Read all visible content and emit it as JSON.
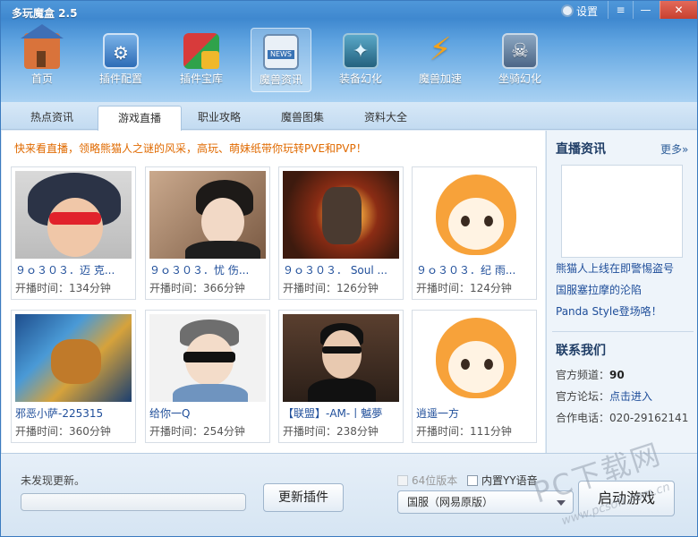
{
  "app": {
    "title": "多玩魔盒 2.5",
    "settings_label": "设置",
    "min_icon": "≡",
    "dash_icon": "—",
    "close_icon": "✕"
  },
  "toolbar": [
    {
      "key": "home",
      "label": "首页",
      "icon": "house-icon"
    },
    {
      "key": "plugin",
      "label": "插件配置",
      "icon": "plugin-config-icon"
    },
    {
      "key": "store",
      "label": "插件宝库",
      "icon": "plugin-store-icon"
    },
    {
      "key": "news",
      "label": "魔兽资讯",
      "icon": "news-icon",
      "active": true
    },
    {
      "key": "equip",
      "label": "装备幻化",
      "icon": "equipment-icon"
    },
    {
      "key": "speed",
      "label": "魔兽加速",
      "icon": "lightning-icon"
    },
    {
      "key": "mount",
      "label": "坐骑幻化",
      "icon": "mount-icon"
    }
  ],
  "subtabs": [
    {
      "label": "热点资讯"
    },
    {
      "label": "游戏直播",
      "active": true
    },
    {
      "label": "职业攻略"
    },
    {
      "label": "魔兽图集"
    },
    {
      "label": "资料大全"
    }
  ],
  "promo_text": "快来看直播，领略熊猫人之谜的风采，高玩、萌妹纸带你玩转PVE和PVP！",
  "streams": [
    {
      "title": "９ｏ３０３．迈 克...",
      "time_label": "开播时间：",
      "time": "134分钟"
    },
    {
      "title": "９ｏ３０３．忧 伤...",
      "time_label": "开播时间：",
      "time": "366分钟"
    },
    {
      "title": "９ｏ３０３．  Soul ...",
      "time_label": "开播时间：",
      "time": "126分钟"
    },
    {
      "title": "９ｏ３０３．纪 雨...",
      "time_label": "开播时间：",
      "time": "124分钟"
    },
    {
      "title": "邪恶小萨-225315",
      "time_label": "开播时间：",
      "time": "360分钟"
    },
    {
      "title": "给你一Q",
      "time_label": "开播时间：",
      "time": "254分钟"
    },
    {
      "title": "【联盟】-AM-丨魆夢",
      "time_label": "开播时间：",
      "time": "238分钟"
    },
    {
      "title": "逍遥一方",
      "time_label": "开播时间：",
      "time": "111分钟"
    }
  ],
  "side": {
    "title": "直播资讯",
    "more": "更多»",
    "links": [
      "熊猫人上线在即警惕盗号",
      "国服塞拉摩的沦陷",
      "Panda Style登场咯！"
    ],
    "contact_title": "联系我们",
    "channel_label": "官方频道：",
    "channel_value": "90",
    "forum_label": "官方论坛：",
    "forum_link": "点击进入",
    "phone_label": "合作电话：",
    "phone_value": "020-29162141"
  },
  "bottom": {
    "update_text": "未发现更新。",
    "progress": 0,
    "update_button": "更新插件",
    "checkbox_64": "64位版本",
    "checkbox_yy": "内置YY语音",
    "server": "国服（网易原版）",
    "start_button": "启动游戏"
  },
  "watermark": {
    "main": "PC下载网",
    "url": "www.pcsoft.com.cn"
  }
}
